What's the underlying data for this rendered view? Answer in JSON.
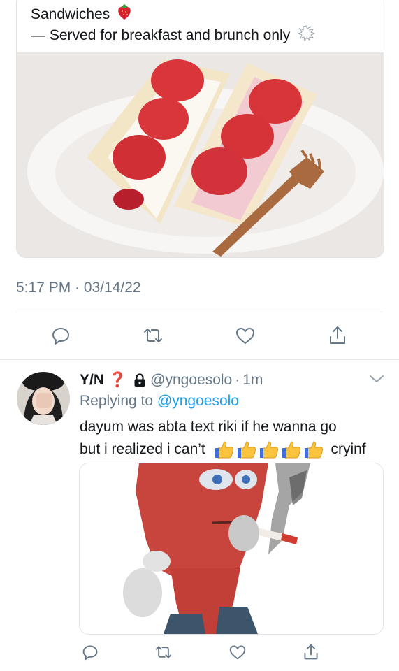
{
  "quoted_tweet": {
    "text_line1": "Sandwiches",
    "text_line2": "— Served for breakfast and brunch only",
    "image_icon": "strawberry-sandwich-photo",
    "timestamp": "5:17 PM · 03/14/22"
  },
  "actions": {
    "icons": [
      "reply-icon",
      "retweet-icon",
      "like-icon",
      "share-icon"
    ]
  },
  "reply": {
    "display_name": "Y/N",
    "red_mark": "❓",
    "handle": "@yngoesolo",
    "separator": "·",
    "time": "1m",
    "replying_prefix": "Replying to ",
    "replying_to": "@yngoesolo",
    "body_line1": "dayum was abta text riki if he wanna go",
    "body_line2_start": "but i realized i can’t",
    "body_line2_end": "cryinf",
    "media_icon": "smoking-cartoon-character-image"
  },
  "colors": {
    "accent": "#1da1f2",
    "muted": "#657786",
    "divider": "#e1e6ea"
  }
}
